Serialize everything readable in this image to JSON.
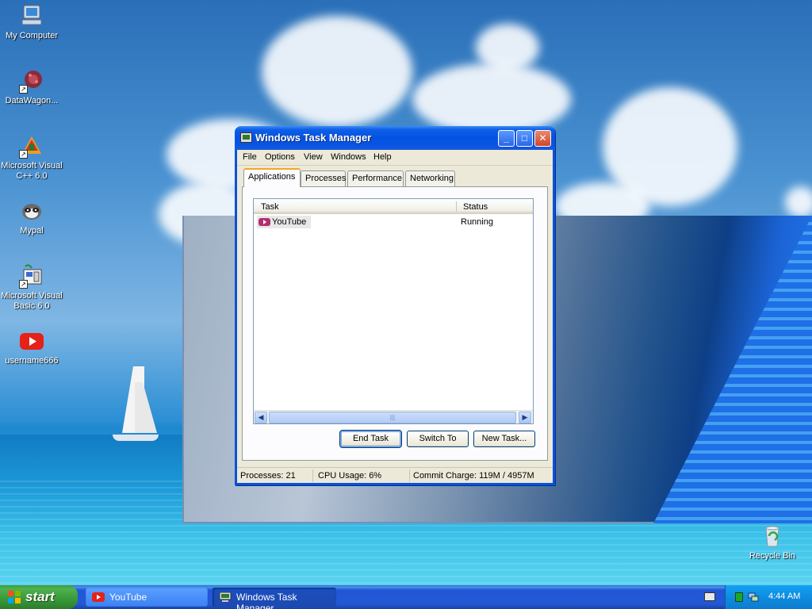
{
  "desktop": {
    "icons": [
      {
        "label": "My Computer",
        "icon": "my-computer-icon"
      },
      {
        "label": "DataWagon...",
        "icon": "datawagon-icon"
      },
      {
        "label": "Microsoft Visual C++ 6.0",
        "icon": "visual-cpp-icon"
      },
      {
        "label": "Mypal",
        "icon": "mypal-raccoon-icon"
      },
      {
        "label": "Microsoft Visual Basic 6.0",
        "icon": "visual-basic-icon"
      },
      {
        "label": "username666",
        "icon": "youtube-icon"
      },
      {
        "label": "Recycle Bin",
        "icon": "recycle-bin-icon"
      }
    ]
  },
  "taskmgr": {
    "title": "Windows Task Manager",
    "title_buttons": {
      "minimize": "_",
      "maximize": "□",
      "close": "✕"
    },
    "menu": [
      "File",
      "Options",
      "View",
      "Windows",
      "Help"
    ],
    "tabs": [
      "Applications",
      "Processes",
      "Performance",
      "Networking"
    ],
    "active_tab": "Applications",
    "columns": [
      "Task",
      "Status"
    ],
    "rows": [
      {
        "task": "YouTube",
        "status": "Running"
      }
    ],
    "scroll_grip": "|||",
    "buttons": {
      "end_task": "End Task",
      "switch_to": "Switch To",
      "new_task": "New Task..."
    },
    "status": {
      "processes": "Processes: 21",
      "cpu": "CPU Usage: 6%",
      "commit": "Commit Charge: 119M / 4957M"
    }
  },
  "taskbar": {
    "start_label": "start",
    "tasks": [
      {
        "label": "YouTube",
        "icon": "youtube-icon"
      },
      {
        "label": "Windows Task Manager",
        "icon": "task-manager-icon"
      }
    ],
    "clock": "4:44 AM"
  },
  "colors": {
    "xp_blue": "#0353e0",
    "start_green": "#389838",
    "youtube_red": "#e62117",
    "tray_blue": "#0f8ce0"
  }
}
